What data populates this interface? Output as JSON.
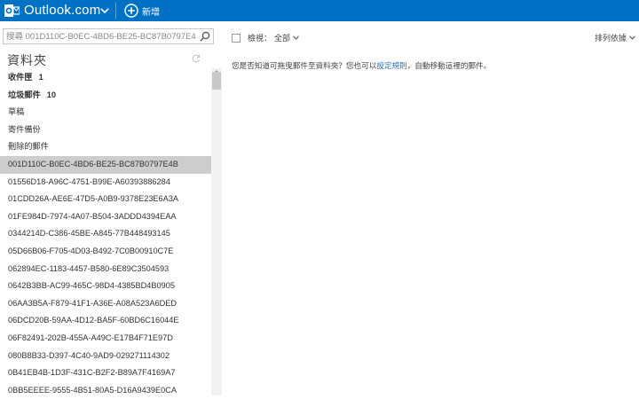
{
  "header": {
    "brand": "Outlook.com",
    "new_label": "新增",
    "colors": {
      "bar": "#0072c6",
      "text": "#ffffff"
    }
  },
  "sidebar": {
    "search_placeholder": "搜尋 001D110C-B0EC-4BD6-BE25-BC87B0797E4",
    "title": "資料夾",
    "items": [
      {
        "label": "收件匣",
        "count": "1",
        "bold": true
      },
      {
        "label": "垃圾郵件",
        "count": "10",
        "bold": true
      },
      {
        "label": "草稿"
      },
      {
        "label": "寄件備份"
      },
      {
        "label": "刪除的郵件"
      },
      {
        "label": "001D110C-B0EC-4BD6-BE25-BC87B0797E4B",
        "selected": true
      },
      {
        "label": "01556D18-A96C-4751-B99E-A60393886284"
      },
      {
        "label": "01CDD26A-AE6E-47D5-A0B9-9378E23E6A3A"
      },
      {
        "label": "01FE984D-7974-4A07-B504-3ADDD4394EAA"
      },
      {
        "label": "0344214D-C386-45BE-A845-77B448493145"
      },
      {
        "label": "05D66B06-F705-4D03-B492-7C0B00910C7E"
      },
      {
        "label": "062894EC-1183-4457-B580-6E89C3504593"
      },
      {
        "label": "0642B3BB-AC99-465C-98D4-4385BD4B0905"
      },
      {
        "label": "06AA3B5A-F879-41F1-A36E-A08A523A6DED"
      },
      {
        "label": "06DCD20B-59AA-4D12-BA5F-60BD6C16044E"
      },
      {
        "label": "06F82491-202B-455A-A49C-E17B4F71E97D"
      },
      {
        "label": "080B8B33-D397-4C40-9AD9-029271114302"
      },
      {
        "label": "0B41EB4B-1D3F-431C-B2F2-B89A7F4169A7"
      },
      {
        "label": "0BB5EEEE-9555-4B51-80A5-D16A9439E0CA"
      }
    ],
    "selected_color": "#cdcdcd"
  },
  "main": {
    "filter_label": "檢視：",
    "filter_value": "全部",
    "sort_label": "排列依據",
    "hint_before": "您是否知道可拖曳郵件至資料夾？您也可以",
    "hint_link": "設定規則",
    "hint_after": "，自動移動這裡的郵件。",
    "link_color": "#2a6fb8"
  }
}
